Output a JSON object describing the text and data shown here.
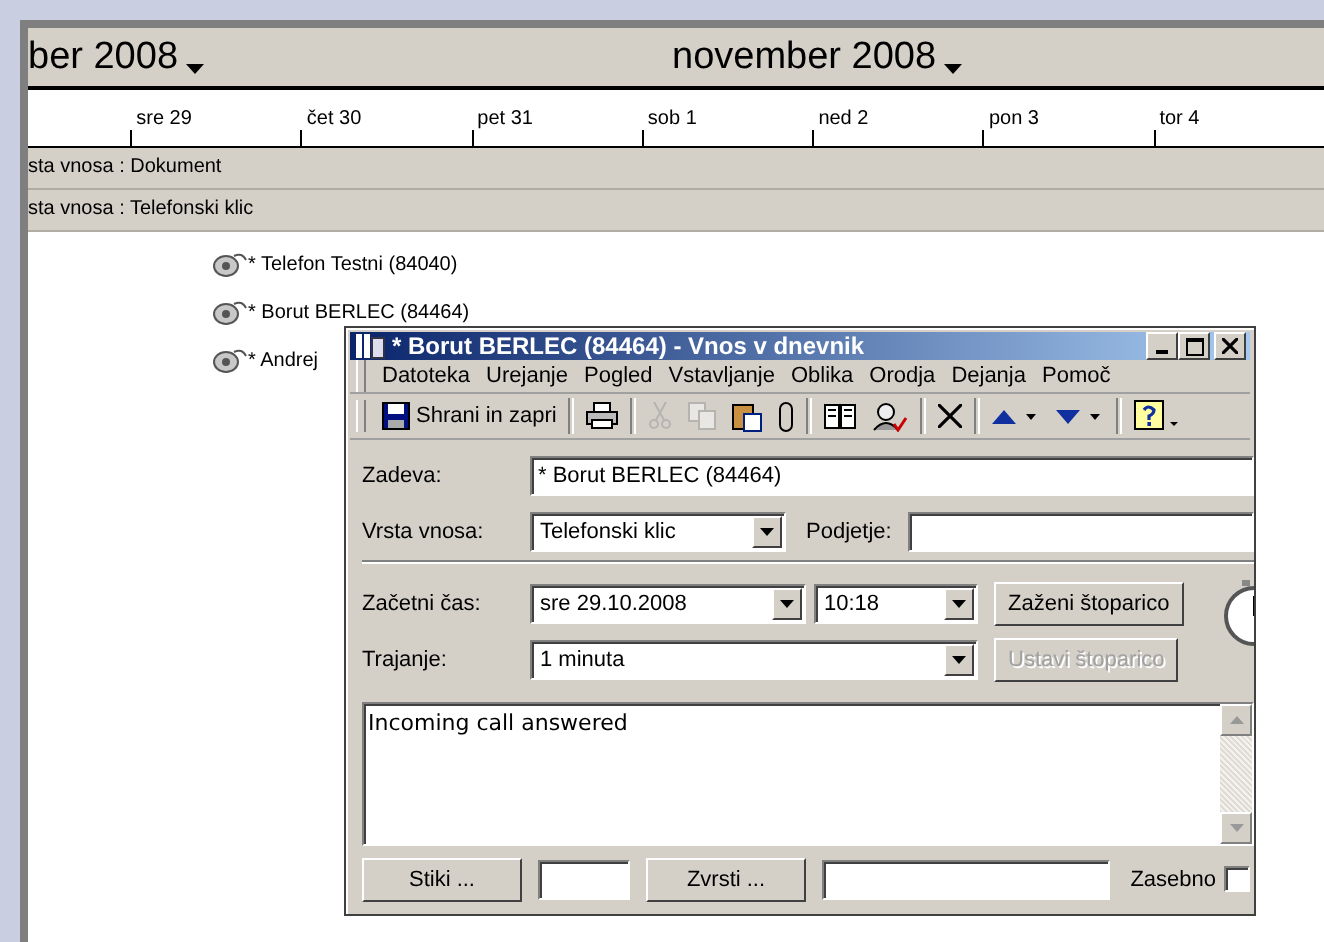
{
  "calendar": {
    "months": [
      {
        "label": "ber 2008"
      },
      {
        "label": "november 2008"
      }
    ],
    "days": [
      "sre 29",
      "čet 30",
      "pet 31",
      "sob 1",
      "ned 2",
      "pon 3",
      "tor 4"
    ],
    "groups": [
      "sta vnosa : Dokument",
      "sta vnosa : Telefonski klic"
    ],
    "entries": [
      "* Telefon Testni (84040)",
      "* Borut BERLEC (84464)",
      "* Andrej"
    ]
  },
  "dialog": {
    "title": "* Borut BERLEC (84464) - Vnos v dnevnik",
    "menu": [
      "Datoteka",
      "Urejanje",
      "Pogled",
      "Vstavljanje",
      "Oblika",
      "Orodja",
      "Dejanja",
      "Pomoč"
    ],
    "toolbar": [
      {
        "kind": "save",
        "label": "Shrani in zapri",
        "disabled": false
      },
      {
        "kind": "sep"
      },
      {
        "kind": "print",
        "disabled": false
      },
      {
        "kind": "sep"
      },
      {
        "kind": "cut",
        "disabled": true
      },
      {
        "kind": "copy",
        "disabled": true
      },
      {
        "kind": "paste",
        "disabled": false
      },
      {
        "kind": "attach",
        "disabled": false
      },
      {
        "kind": "sep"
      },
      {
        "kind": "book",
        "disabled": false
      },
      {
        "kind": "names",
        "disabled": false
      },
      {
        "kind": "sep"
      },
      {
        "kind": "delete",
        "disabled": false
      },
      {
        "kind": "sep"
      },
      {
        "kind": "up",
        "disabled": false
      },
      {
        "kind": "down",
        "disabled": false
      },
      {
        "kind": "sep"
      },
      {
        "kind": "help",
        "disabled": false
      }
    ],
    "subject": {
      "label": "Zadeva:",
      "value": "* Borut BERLEC (84464)"
    },
    "entry_type": {
      "label": "Vrsta vnosa:",
      "value": "Telefonski klic"
    },
    "company": {
      "label": "Podjetje:"
    },
    "start": {
      "label": "Začetni čas:",
      "date": "sre 29.10.2008",
      "time": "10:18"
    },
    "start_button": {
      "label": "Zaženi štoparico",
      "disabled": false
    },
    "duration": {
      "label": "Trajanje:",
      "value": "1 minuta"
    },
    "stop_button": {
      "label": "Ustavi štoparico",
      "disabled": true
    },
    "notes": "Incoming call answered",
    "contacts_button": "Stiki ...",
    "categories_button": "Zvrsti ...",
    "private": {
      "label": "Zasebno",
      "checked": false
    }
  }
}
